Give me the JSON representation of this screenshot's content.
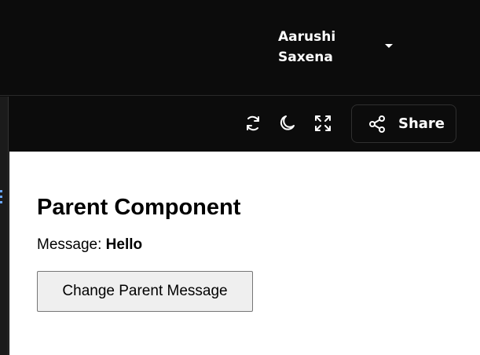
{
  "header": {
    "user_first_name": "Aarushi",
    "user_last_name": "Saxena"
  },
  "toolbar": {
    "share_label": "Share",
    "icons": [
      "refresh-icon",
      "moon-icon",
      "fullscreen-icon",
      "share-icon"
    ]
  },
  "preview": {
    "title": "Parent Component",
    "message_label": "Message:",
    "message_value": "Hello",
    "button_label": "Change Parent Message"
  },
  "colors": {
    "app_background": "#0c0c0c",
    "icon_color": "#ffffff",
    "preview_background": "#ffffff",
    "button_background": "#efefef",
    "button_border": "#767676"
  }
}
